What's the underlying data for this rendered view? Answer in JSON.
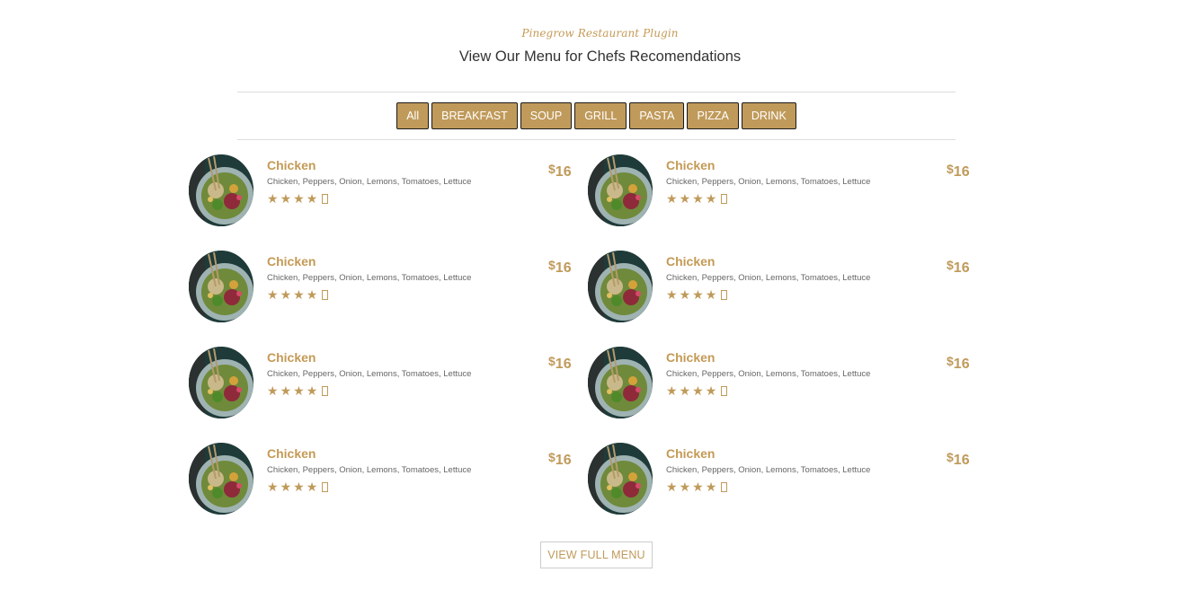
{
  "header": {
    "subtitle": "Pinegrow Restaurant Plugin",
    "title": "View Our Menu for Chefs Recomendations"
  },
  "filters": [
    "All",
    "BREAKFAST",
    "SOUP",
    "GRILL",
    "PASTA",
    "PIZZA",
    "DRINK"
  ],
  "menu_items": [
    {
      "name": "Chicken",
      "description": "Chicken, Peppers, Onion, Lemons, Tomatoes, Lettuce",
      "currency": "$",
      "price": "16",
      "rating": 4,
      "rating_max": 5
    },
    {
      "name": "Chicken",
      "description": "Chicken, Peppers, Onion, Lemons, Tomatoes, Lettuce",
      "currency": "$",
      "price": "16",
      "rating": 4,
      "rating_max": 5
    },
    {
      "name": "Chicken",
      "description": "Chicken, Peppers, Onion, Lemons, Tomatoes, Lettuce",
      "currency": "$",
      "price": "16",
      "rating": 4,
      "rating_max": 5
    },
    {
      "name": "Chicken",
      "description": "Chicken, Peppers, Onion, Lemons, Tomatoes, Lettuce",
      "currency": "$",
      "price": "16",
      "rating": 4,
      "rating_max": 5
    },
    {
      "name": "Chicken",
      "description": "Chicken, Peppers, Onion, Lemons, Tomatoes, Lettuce",
      "currency": "$",
      "price": "16",
      "rating": 4,
      "rating_max": 5
    },
    {
      "name": "Chicken",
      "description": "Chicken, Peppers, Onion, Lemons, Tomatoes, Lettuce",
      "currency": "$",
      "price": "16",
      "rating": 4,
      "rating_max": 5
    },
    {
      "name": "Chicken",
      "description": "Chicken, Peppers, Onion, Lemons, Tomatoes, Lettuce",
      "currency": "$",
      "price": "16",
      "rating": 4,
      "rating_max": 5
    },
    {
      "name": "Chicken",
      "description": "Chicken, Peppers, Onion, Lemons, Tomatoes, Lettuce",
      "currency": "$",
      "price": "16",
      "rating": 4,
      "rating_max": 5
    }
  ],
  "footer": {
    "full_menu_label": "VIEW FULL MENU"
  },
  "colors": {
    "accent": "#c09a5a",
    "text": "#333333",
    "muted": "#666666"
  }
}
